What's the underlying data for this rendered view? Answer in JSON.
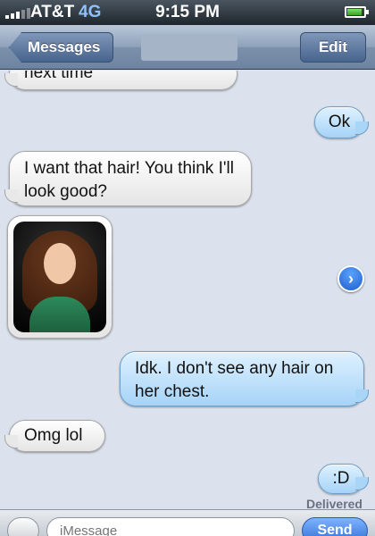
{
  "status_bar": {
    "carrier": "AT&T",
    "network": "4G",
    "time": "9:15 PM"
  },
  "nav": {
    "back_label": "Messages",
    "edit_label": "Edit"
  },
  "messages": [
    {
      "direction": "incoming",
      "text": "next time"
    },
    {
      "direction": "outgoing",
      "text": "Ok"
    },
    {
      "direction": "incoming",
      "text": "I want that hair! You think I'll look good?"
    },
    {
      "direction": "incoming",
      "type": "photo"
    },
    {
      "direction": "outgoing",
      "text": "Idk. I don't see any hair on her chest."
    },
    {
      "direction": "incoming",
      "text": "Omg lol"
    },
    {
      "direction": "outgoing",
      "text": ":D"
    }
  ],
  "delivery_status": "Delivered",
  "input_bar": {
    "placeholder": "iMessage",
    "send_label": "Send"
  },
  "colors": {
    "background": "#dbe2ed",
    "outgoing_bubble": "#a6d3f7",
    "incoming_bubble": "#ffffff",
    "nav_button": "#47648e"
  }
}
